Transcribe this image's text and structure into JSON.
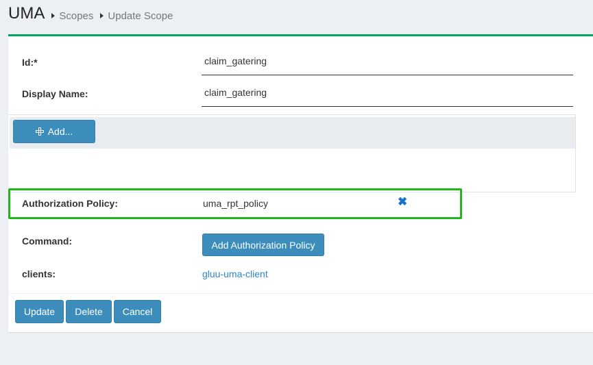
{
  "header": {
    "title": "UMA",
    "breadcrumbs": [
      "Scopes",
      "Update Scope"
    ]
  },
  "form": {
    "id_label": "Id:*",
    "id_value": "claim_gatering",
    "display_name_label": "Display Name:",
    "display_name_value": "claim_gatering",
    "add_button_label": "Add...",
    "authorization_policy_label": "Authorization Policy:",
    "authorization_policy_value": "uma_rpt_policy",
    "command_label": "Command:",
    "add_policy_button_label": "Add Authorization Policy",
    "clients_label": "clients:",
    "client_link": "gluu-uma-client"
  },
  "actions": {
    "update": "Update",
    "delete": "Delete",
    "cancel": "Cancel"
  },
  "colors": {
    "accent_top_border": "#00a65a",
    "highlight_box": "#22b51c",
    "primary_button": "#3c8dbc",
    "link": "#2a86c8"
  }
}
